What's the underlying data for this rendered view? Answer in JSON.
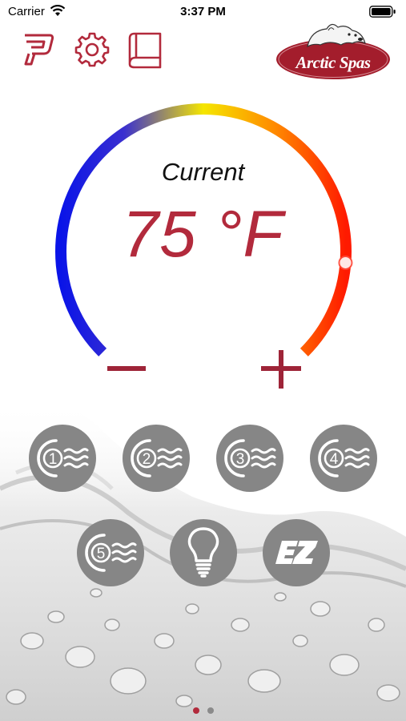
{
  "status_bar": {
    "carrier": "Carrier",
    "time": "3:37 PM"
  },
  "top_bar": {
    "icons": [
      "p-logo-icon",
      "gear-icon",
      "manual-book-icon"
    ],
    "brand_logo_text": "Arctic Spas"
  },
  "thermostat": {
    "label": "Current",
    "temperature": "75 °F",
    "decrease": "−",
    "increase": "+",
    "setpoint_fraction": 0.85
  },
  "controls": {
    "pumps": [
      {
        "number": "1"
      },
      {
        "number": "2"
      },
      {
        "number": "3"
      },
      {
        "number": "4"
      },
      {
        "number": "5"
      }
    ],
    "light_icon": "light-bulb-icon",
    "ez_label": "EZ"
  },
  "pager": {
    "count": 2,
    "active": 1
  },
  "colors": {
    "brand_red": "#b22a3c",
    "button_gray": "#868686",
    "gauge_cold": "#0a14e8",
    "gauge_mid": "#f5e600",
    "gauge_hot": "#ff1a00"
  }
}
